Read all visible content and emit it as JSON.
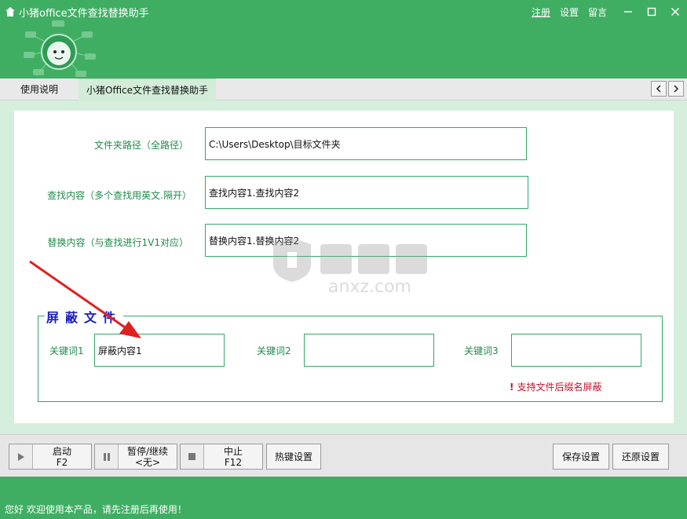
{
  "window": {
    "title": "小猪office文件查找替换助手",
    "links": [
      "注册",
      "设置",
      "留言"
    ],
    "accent_color": "#3fae63"
  },
  "tabs": [
    {
      "label": "使用说明",
      "active": false
    },
    {
      "label": "小猪Office文件查找替换助手",
      "active": true
    }
  ],
  "form": {
    "folder_label": "文件夹路径（全路径）",
    "folder_value": "C:\\Users\\Desktop\\目标文件夹",
    "find_label": "查找内容（多个查找用英文.隔开）",
    "find_value": "查找内容1.查找内容2",
    "replace_label": "替换内容（与查找进行1V1对应）",
    "replace_value": "替换内容1.替换内容2"
  },
  "shield": {
    "title": "屏蔽文件",
    "kw1_label": "关键词1",
    "kw1_value": "屏蔽内容1",
    "kw2_label": "关键词2",
    "kw2_value": "",
    "kw3_label": "关键词3",
    "kw3_value": "",
    "note": "支持文件后缀名屏蔽"
  },
  "watermark": {
    "text": "anxz.com"
  },
  "toolbar": {
    "start_label": "启动",
    "start_key": "F2",
    "pause_label": "暂停/继续",
    "pause_key": "<无>",
    "stop_label": "中止",
    "stop_key": "F12",
    "hotkey_label": "热键设置",
    "save_label": "保存设置",
    "restore_label": "还原设置"
  },
  "status": {
    "text": "您好 欢迎使用本产品，请先注册后再使用！"
  },
  "icons": [
    "app-logo-icon",
    "mascot-icon",
    "minimize-icon",
    "maximize-icon",
    "close-icon",
    "chevron-left-icon",
    "chevron-right-icon",
    "play-icon",
    "pause-icon",
    "stop-icon"
  ]
}
